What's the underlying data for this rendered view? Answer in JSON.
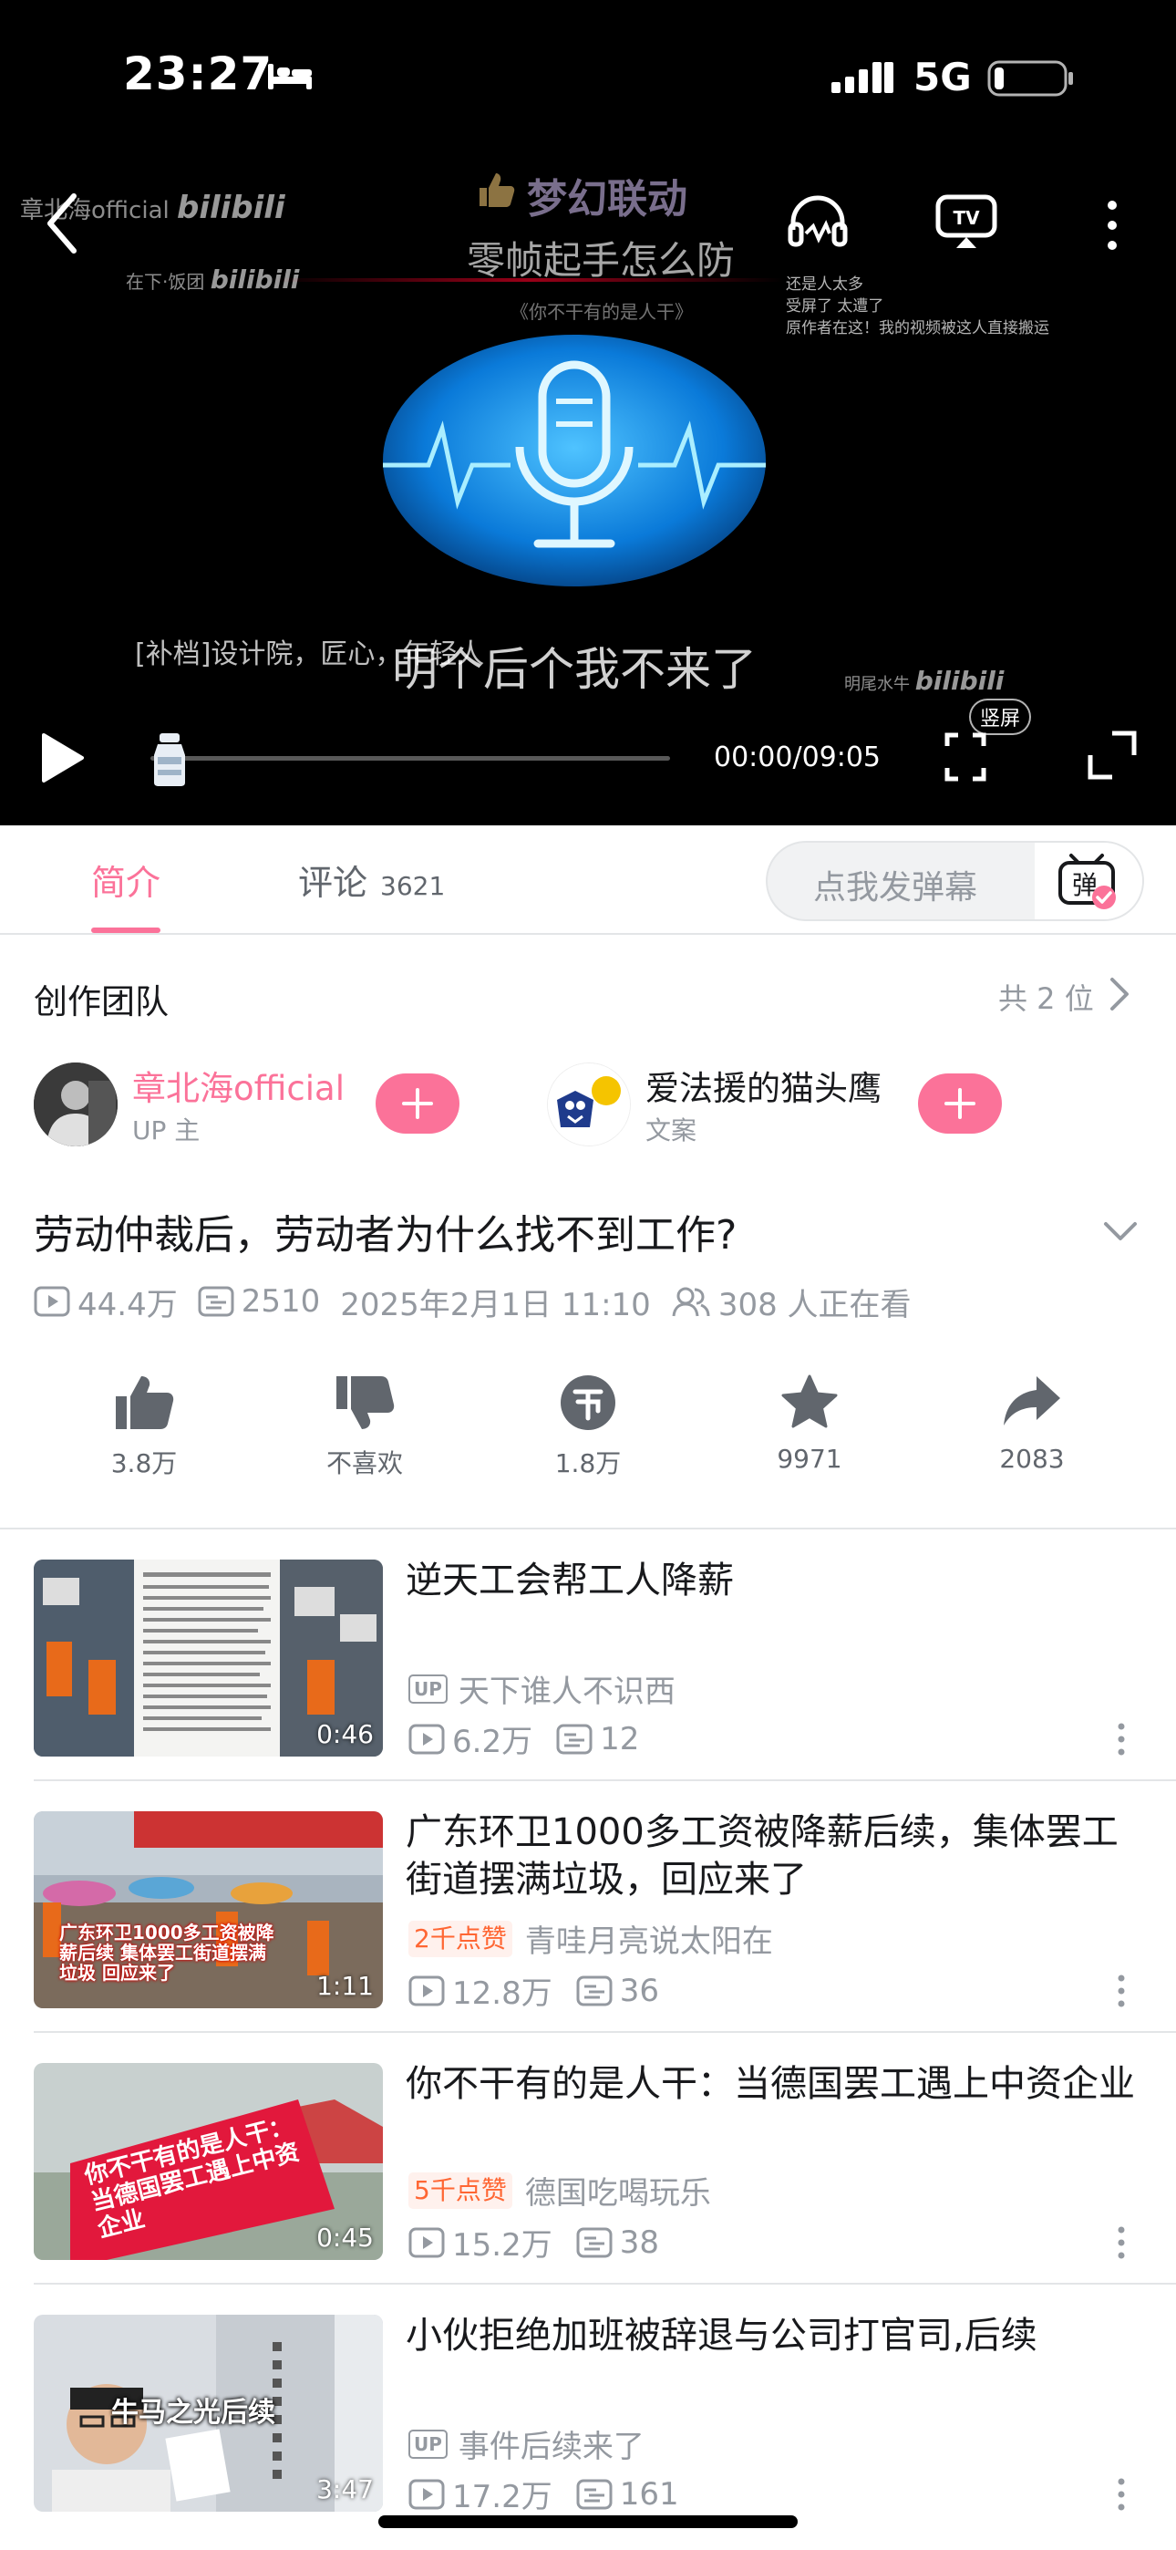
{
  "status_bar": {
    "time": "23:27",
    "network": "5G"
  },
  "player": {
    "watermark_left_1": "章北海official",
    "watermark_left_2": "在下·饭团",
    "watermark_logo": "bilibili",
    "watermark_bottom_right": "明尾水牛",
    "banner_title": "梦幻联动",
    "banner_subtitle": "零帧起手怎么防",
    "banner_note": "《你不干有的是人干》",
    "danmaku_lines": [
      "还是人太多",
      "受屏了  太遭了",
      "原作者在这！我的视频被这人直接搬运"
    ],
    "subtitle_small": "[补档]设计院，匠心，年轻人",
    "subtitle_main": "明个后个我不来了",
    "progress": 0,
    "time_readout": "00:00/09:05",
    "portrait_label": "竖屏"
  },
  "tabs": {
    "intro": "简介",
    "comments": "评论",
    "comments_count": "3621",
    "danmaku_placeholder": "点我发弹幕",
    "danmaku_toggle": "弹"
  },
  "team": {
    "title": "创作团队",
    "count": "共 2 位",
    "members": [
      {
        "name": "章北海official",
        "role": "UP 主",
        "name_color": "#fb7299"
      },
      {
        "name": "爱法援的猫头鹰",
        "role": "文案",
        "name_color": "#18191c"
      }
    ]
  },
  "video": {
    "title": "劳动仲裁后，劳动者为什么找不到工作?",
    "views": "44.4万",
    "danmaku": "2510",
    "date": "2025年2月1日 11:10",
    "watching": "308 人正在看"
  },
  "actions": [
    {
      "label": "3.8万",
      "icon": "thumbs-up-icon"
    },
    {
      "label": "不喜欢",
      "icon": "thumbs-down-icon"
    },
    {
      "label": "1.8万",
      "icon": "coin-icon"
    },
    {
      "label": "9971",
      "icon": "star-icon"
    },
    {
      "label": "2083",
      "icon": "share-icon"
    }
  ],
  "related": [
    {
      "title": "逆天工会帮工人降薪",
      "author": "天下谁人不识西",
      "badge_type": "up",
      "badge_text": "UP",
      "views": "6.2万",
      "danmaku": "12",
      "duration": "0:46"
    },
    {
      "title": "广东环卫1000多工资被降薪后续，集体罢工街道摆满垃圾，回应来了",
      "author": "青哇月亮说太阳在",
      "badge_type": "like",
      "badge_text": "2千点赞",
      "views": "12.8万",
      "danmaku": "36",
      "duration": "1:11",
      "thumb_text": "广东环卫1000多工资被降薪后续 集体罢工街道摆满垃圾 回应来了"
    },
    {
      "title": "你不干有的是人干：当德国罢工遇上中资企业",
      "author": "德国吃喝玩乐",
      "badge_type": "like",
      "badge_text": "5千点赞",
      "views": "15.2万",
      "danmaku": "38",
      "duration": "0:45",
      "thumb_text": "你不干有的是人干：当德国罢工遇上中资企业"
    },
    {
      "title": "小伙拒绝加班被辞退与公司打官司,后续",
      "author": "事件后续来了",
      "badge_type": "up",
      "badge_text": "UP",
      "views": "17.2万",
      "danmaku": "161",
      "duration": "3:47",
      "thumb_text": "牛马之光后续"
    }
  ],
  "colors": {
    "brand_pink": "#fb7299",
    "muted": "#9499a0",
    "like_orange": "#ff6633"
  }
}
